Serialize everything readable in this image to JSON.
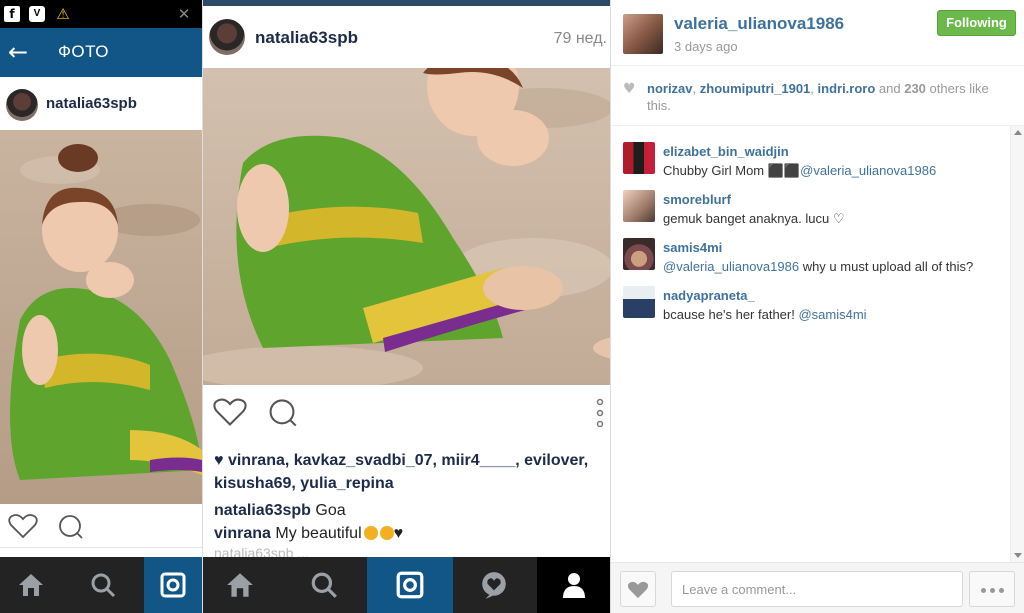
{
  "left_phone": {
    "status_icons": {
      "facebook_glyph": "f",
      "vpn_glyph": "V",
      "warning_glyph": "⚠",
      "signal_glyph": "✕"
    },
    "app_bar": {
      "back_glyph": "←",
      "title": "ФОТО"
    },
    "post": {
      "username": "natalia63spb"
    },
    "nav_icons": [
      "home-icon",
      "search-icon",
      "camera-icon"
    ],
    "active_tab": "camera-icon"
  },
  "middle_phone": {
    "post": {
      "username": "natalia63spb",
      "time": "79 нед."
    },
    "likes_line": "♥ vinrana, kavkaz_svadbi_07, miir4____, evilover, kisusha69, yulia_repina",
    "captions": [
      {
        "user": "natalia63spb",
        "text": " Goa"
      },
      {
        "user": "vinrana",
        "text": " My beautiful",
        "suffix": "♥"
      }
    ],
    "faded_line": "natalia63spb ...",
    "nav_icons": [
      "home-icon",
      "search-icon",
      "camera-icon",
      "activity-icon",
      "profile-icon"
    ],
    "active_tab": "camera-icon"
  },
  "panel": {
    "header": {
      "username": "valeria_ulianova1986",
      "time": "3 days ago",
      "follow_label": "Following"
    },
    "likes": {
      "users": [
        "norizav",
        "zhoumiputri_1901",
        "indri.roro"
      ],
      "sep1": ", ",
      "sep2": ", ",
      "and_text": " and ",
      "count": "230",
      "suffix": " others like this."
    },
    "comments": [
      {
        "user": "elizabet_bin_waidjin",
        "text": "Chubby Girl Mom ⬛⬛",
        "mention": "@valeria_ulianova1986",
        "after": ""
      },
      {
        "user": "smoreblurf",
        "text": "gemuk banget anaknya. lucu ♡",
        "mention": "",
        "after": ""
      },
      {
        "user": "samis4mi",
        "text": "",
        "mention": "@valeria_ulianova1986",
        "after": " why u must upload all of this?"
      },
      {
        "user": "nadyapraneta_",
        "text": "bcause he's her father! ",
        "mention": "@samis4mi",
        "after": ""
      }
    ],
    "comment_box": {
      "placeholder": "Leave a comment..."
    }
  },
  "colors": {
    "ig_blue": "#125688",
    "link_blue": "#3f729b",
    "follow_green": "#6bb84b",
    "nav_dark": "#232323"
  }
}
